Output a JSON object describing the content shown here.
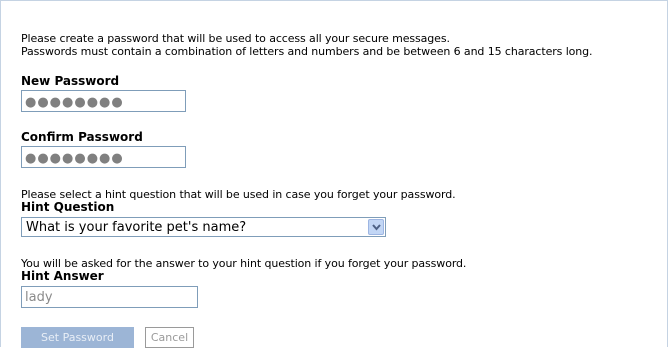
{
  "intro": {
    "line1": "Please create a password that will be used to access all your secure messages.",
    "line2": "Passwords must contain a combination of letters and numbers and be between 6 and 15 characters long."
  },
  "new_password": {
    "label": "New Password",
    "value": "●●●●●●●●"
  },
  "confirm_password": {
    "label": "Confirm Password",
    "value": "●●●●●●●●"
  },
  "hint_question": {
    "description": "Please select a hint question that will be used in case you forget your password.",
    "label": "Hint Question",
    "selected": "What is your favorite pet's name?"
  },
  "hint_answer": {
    "description": "You will be asked for the answer to your hint question if you forget your password.",
    "label": "Hint Answer",
    "value": "lady"
  },
  "buttons": {
    "set_password": "Set Password",
    "cancel": "Cancel"
  },
  "colors": {
    "border": "#7f9db9",
    "primary_button": "#9cb5d6",
    "frame": "#c5d3e3"
  }
}
